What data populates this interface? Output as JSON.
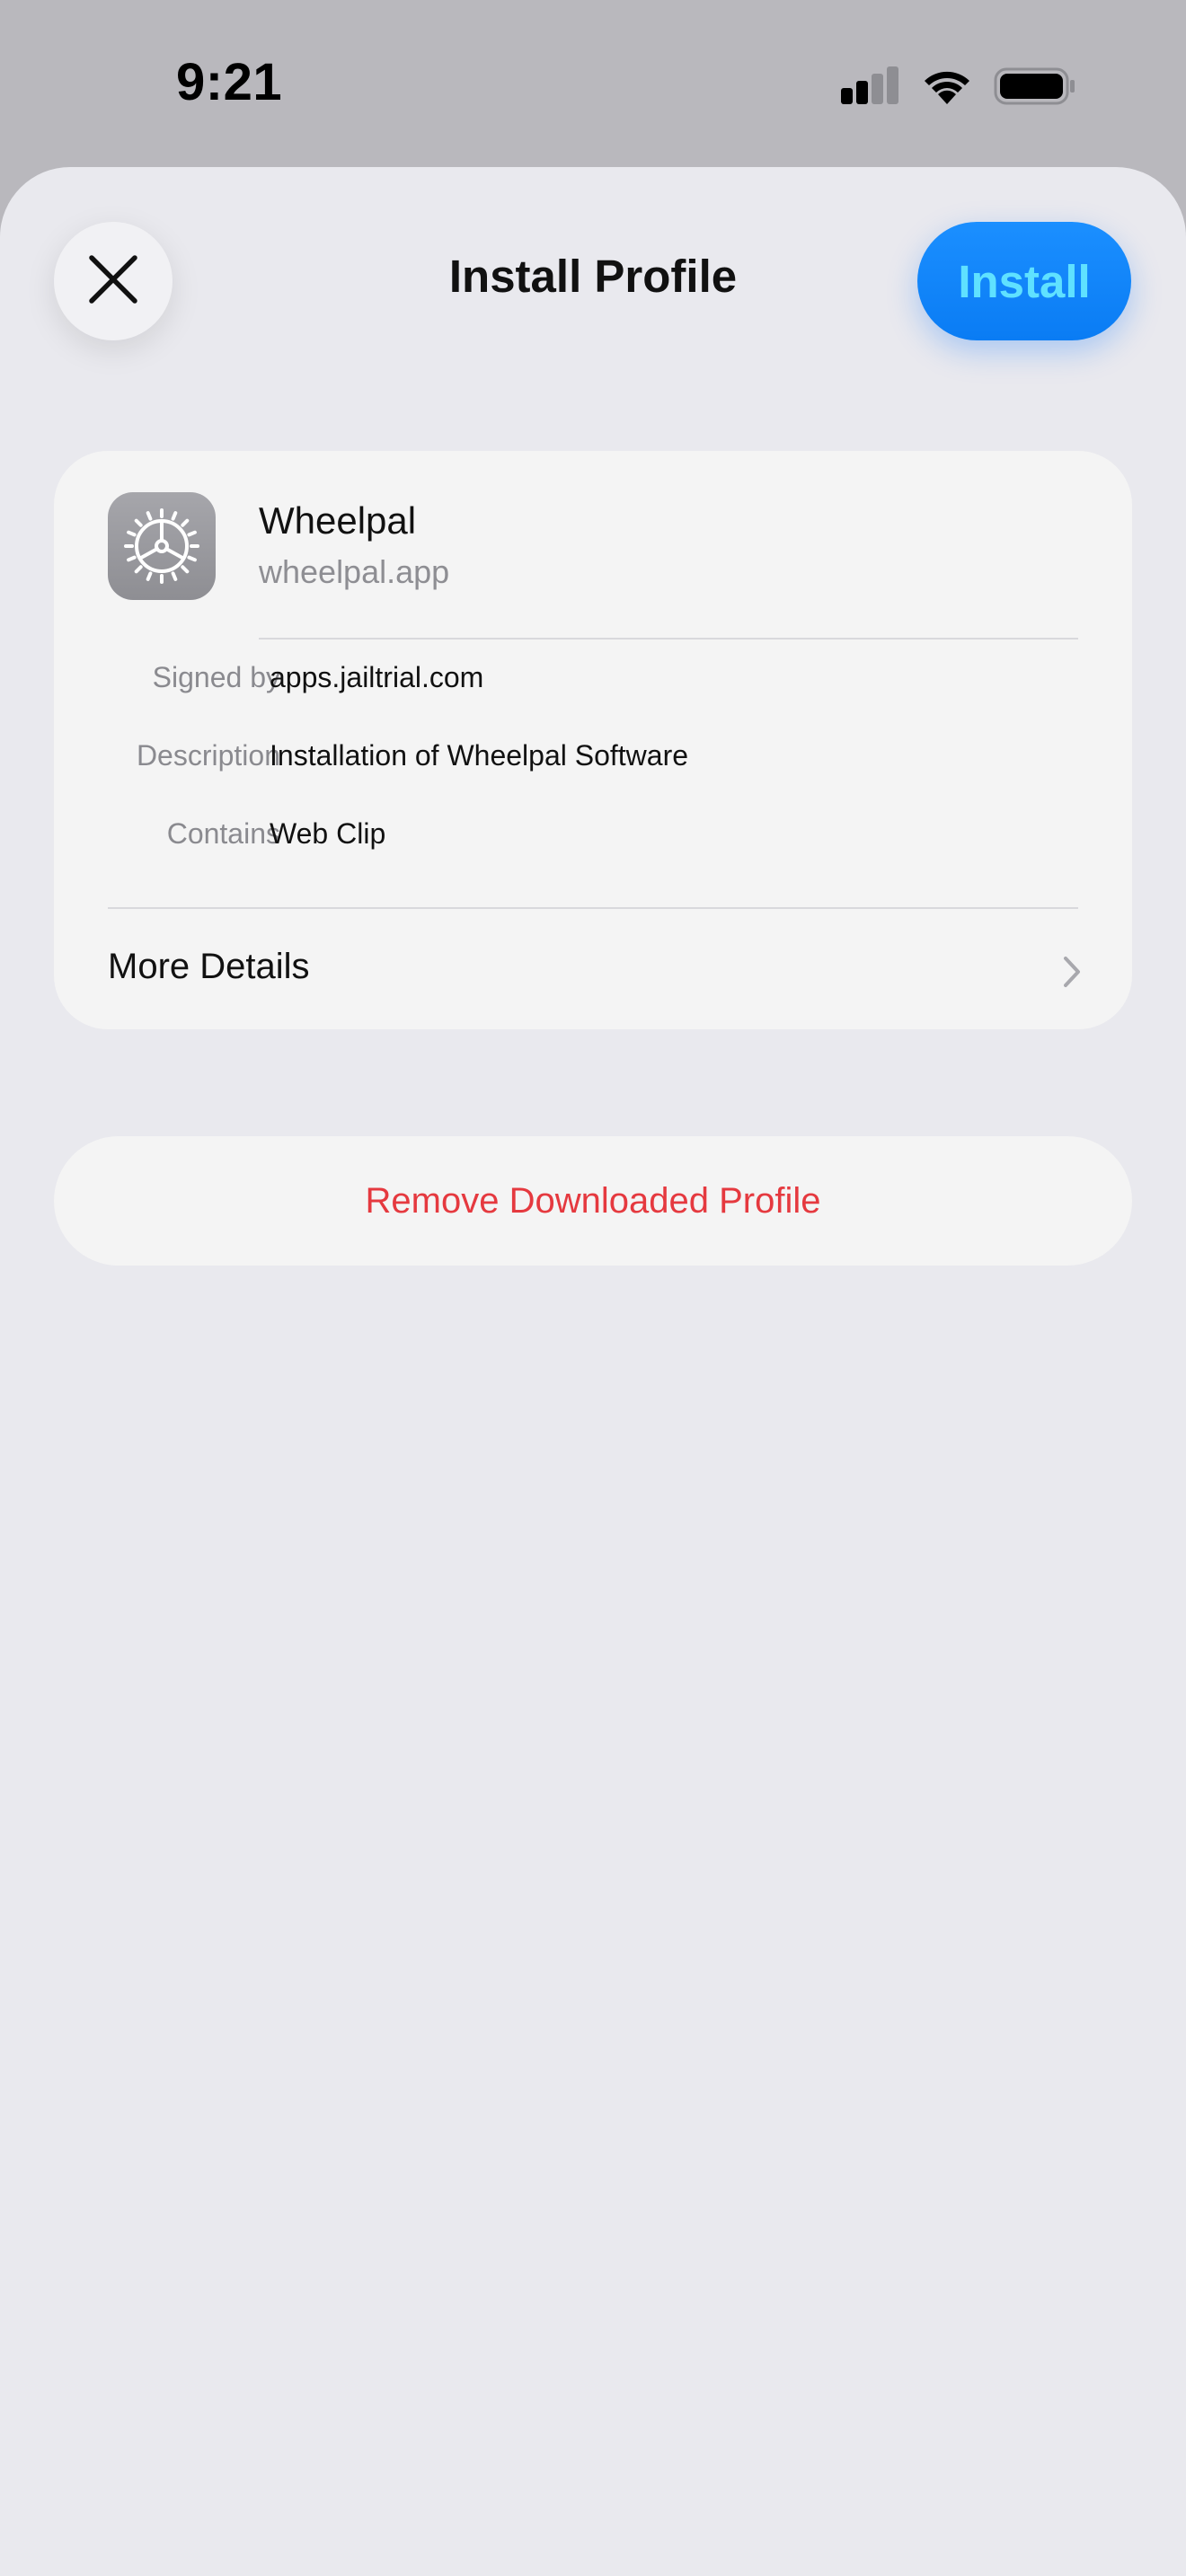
{
  "status_bar": {
    "time": "9:21",
    "icons": [
      "cellular-signal-icon",
      "wifi-icon",
      "battery-icon"
    ]
  },
  "header": {
    "title": "Install Profile",
    "close_icon": "close-icon",
    "install_label": "Install"
  },
  "profile": {
    "icon": "settings-gear-icon",
    "name": "Wheelpal",
    "domain": "wheelpal.app",
    "details": [
      {
        "label": "Signed by",
        "value": "apps.jailtrial.com"
      },
      {
        "label": "Description",
        "value": "Installation of Wheelpal Software"
      },
      {
        "label": "Contains",
        "value": "Web Clip"
      }
    ],
    "more_details_label": "More Details"
  },
  "actions": {
    "remove_label": "Remove Downloaded Profile"
  },
  "colors": {
    "accent": "#0a84ff",
    "install_text": "#5fe1ff",
    "destructive": "#e5393f",
    "sheet_background": "#e9e9ee",
    "card_background": "#f4f4f4"
  }
}
